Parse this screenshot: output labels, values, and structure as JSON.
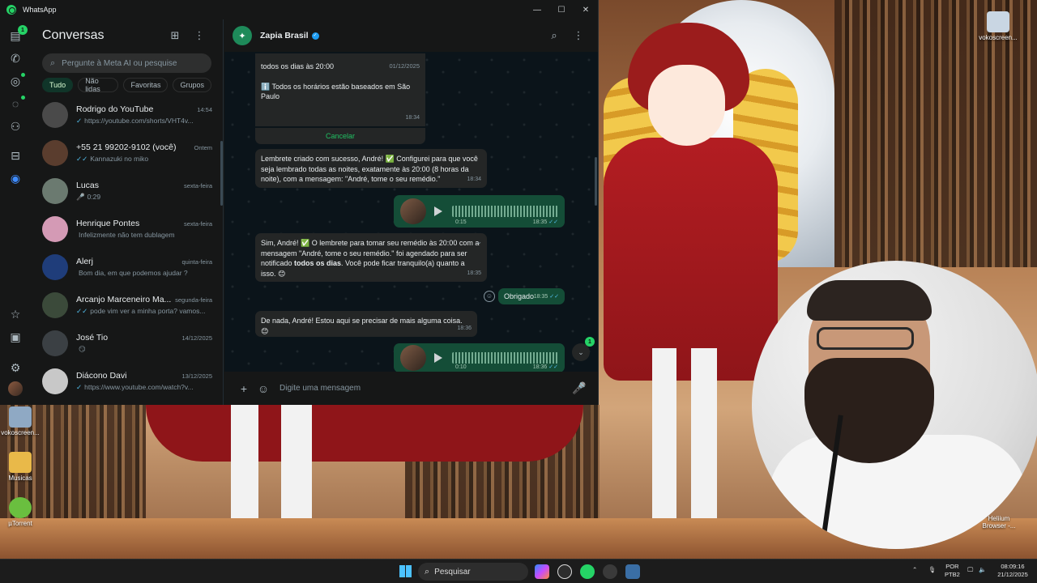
{
  "window": {
    "title": "WhatsApp",
    "min": "—",
    "max": "☐",
    "close": "✕"
  },
  "rail": {
    "chats_badge": "1"
  },
  "chatlist": {
    "title": "Conversas",
    "search_placeholder": "Pergunte à Meta AI ou pesquise",
    "filters": [
      "Tudo",
      "Não lidas",
      "Favoritas",
      "Grupos"
    ],
    "rows": [
      {
        "name": "Rodrigo do YouTube",
        "time": "14:54",
        "tick": "✓",
        "msg": "https://youtube.com/shorts/VHT4v...",
        "avatar_color": "#4a4a4a"
      },
      {
        "name": "+55 21 99202-9102 (você)",
        "time": "Ontem",
        "tick": "✓✓",
        "msg": "Kannazuki no miko",
        "avatar_color": "#5a3d2e"
      },
      {
        "name": "Lucas",
        "time": "sexta-feira",
        "tick": "🎤",
        "msg": "0:29",
        "avatar_color": "#6b7a70"
      },
      {
        "name": "Henrique Pontes",
        "time": "sexta-feira",
        "tick": "",
        "msg": "Infelizmente não tem dublagem",
        "avatar_color": "#d49ab5"
      },
      {
        "name": "Alerj",
        "time": "quinta-feira",
        "tick": "",
        "msg": "Bom dia, em que podemos ajudar ?",
        "avatar_color": "#1f3d7a"
      },
      {
        "name": "Arcanjo Marceneiro Ma...",
        "time": "segunda-feira",
        "tick": "✓✓",
        "msg": "pode vim ver a minha porta? vamos...",
        "avatar_color": "#3b4a3a"
      },
      {
        "name": "José Tio",
        "time": "14/12/2025",
        "tick": "",
        "msg": "😏",
        "avatar_color": "#3b4044"
      },
      {
        "name": "Diácono Davi",
        "time": "13/12/2025",
        "tick": "✓",
        "msg": "https://www.youtube.com/watch?v...",
        "avatar_color": "#c8c8c8"
      }
    ]
  },
  "conversation": {
    "name": "Zapia Brasil",
    "composer_placeholder": "Digite uma mensagem",
    "schedule": {
      "line": "todos os dias às 20:00",
      "date": "01/12/2025",
      "note": "ℹ️ Todos os horários estão baseados em São Paulo",
      "time": "18:34",
      "cancel": "Cancelar"
    },
    "msg1": {
      "text": "Lembrete criado com sucesso, André! ✅ Configurei para que você seja lembrado todas as noites, exatamente às 20:00 (8 horas da noite), com a mensagem: \"André, tome o seu remédio.\"",
      "time": "18:34"
    },
    "voice1": {
      "duration": "0:15",
      "time": "18:35"
    },
    "msg2": {
      "pre": "Sim, André! ✅ O lembrete para tomar seu remédio às 20:00 com a mensagem \"André, tome o seu remédio.\" foi agendado para ser notificado ",
      "bold": "todos os dias",
      "post": ". Você pode ficar tranquilo(a) quanto a isso. 😊",
      "time": "18:35"
    },
    "msg3": {
      "text": "Obrigado",
      "time": "18:35"
    },
    "msg4": {
      "text": "De nada, André! Estou aqui se precisar de mais alguma coisa. 😊",
      "time": "18:36"
    },
    "voice2": {
      "duration": "0:10",
      "time": "18:36"
    },
    "unread_badge": "1"
  },
  "desktop": {
    "icons": [
      "vokoscreen...",
      "vokoscreen...",
      "Musicas",
      "µTorrent",
      "Heliium Browser -..."
    ]
  },
  "taskbar": {
    "search": "Pesquisar",
    "lang1": "POR",
    "lang2": "PTB2",
    "time": "08:09:16",
    "date": "21/12/2025"
  }
}
